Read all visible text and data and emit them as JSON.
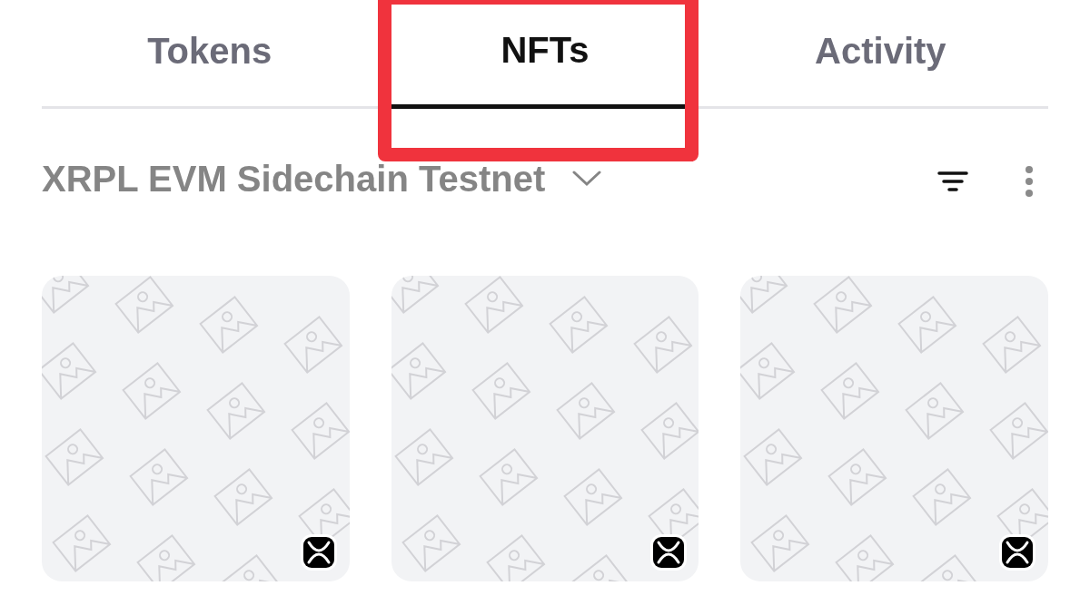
{
  "tabs": [
    {
      "label": "Tokens",
      "selected": false,
      "highlighted": false
    },
    {
      "label": "NFTs",
      "selected": true,
      "highlighted": true
    },
    {
      "label": "Activity",
      "selected": false,
      "highlighted": false
    }
  ],
  "network": {
    "label": "XRPL EVM Sidechain Testnet"
  },
  "nfts": [
    {
      "kind": "placeholder"
    },
    {
      "kind": "placeholder"
    },
    {
      "kind": "placeholder"
    }
  ]
}
